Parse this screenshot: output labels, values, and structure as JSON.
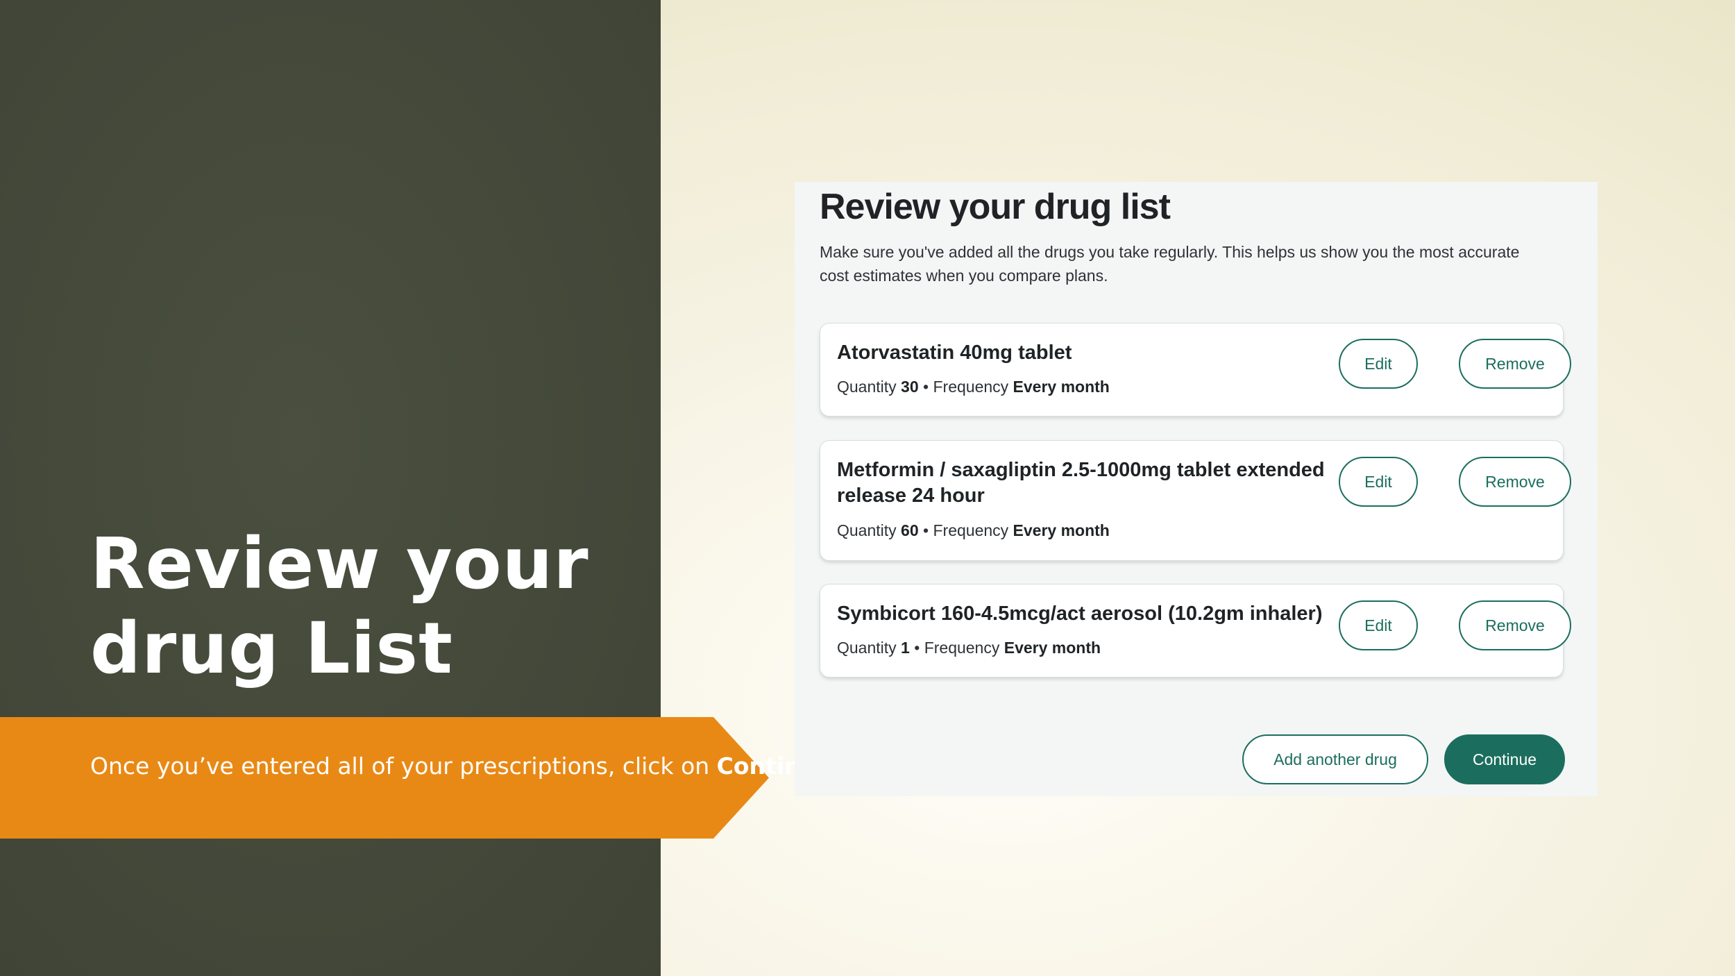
{
  "slide": {
    "title": "Review your drug List",
    "banner_text_prefix": "Once you’ve entered all of your prescriptions, click on ",
    "banner_text_bold": "Continue",
    "banner_text_suffix": "."
  },
  "page": {
    "heading": "Review your drug list",
    "description": "Make sure you've added all the drugs you take regularly. This helps us show you the most accurate cost estimates when you compare plans."
  },
  "drugs": [
    {
      "name": "Atorvastatin 40mg tablet",
      "quantity_label": "Quantity",
      "quantity": "30",
      "separator": "•",
      "frequency_label": "Frequency",
      "frequency": "Every month",
      "edit_label": "Edit",
      "remove_label": "Remove"
    },
    {
      "name": "Metformin / saxagliptin 2.5-1000mg tablet extended release 24 hour",
      "quantity_label": "Quantity",
      "quantity": "60",
      "separator": "•",
      "frequency_label": "Frequency",
      "frequency": "Every month",
      "edit_label": "Edit",
      "remove_label": "Remove"
    },
    {
      "name": "Symbicort 160-4.5mcg/act aerosol (10.2gm inhaler)",
      "quantity_label": "Quantity",
      "quantity": "1",
      "separator": "•",
      "frequency_label": "Frequency",
      "frequency": "Every month",
      "edit_label": "Edit",
      "remove_label": "Remove"
    }
  ],
  "actions": {
    "add_another_label": "Add another drug",
    "continue_label": "Continue"
  },
  "colors": {
    "left_panel": "#454a3b",
    "banner": "#e88916",
    "accent": "#1b6e5e"
  }
}
